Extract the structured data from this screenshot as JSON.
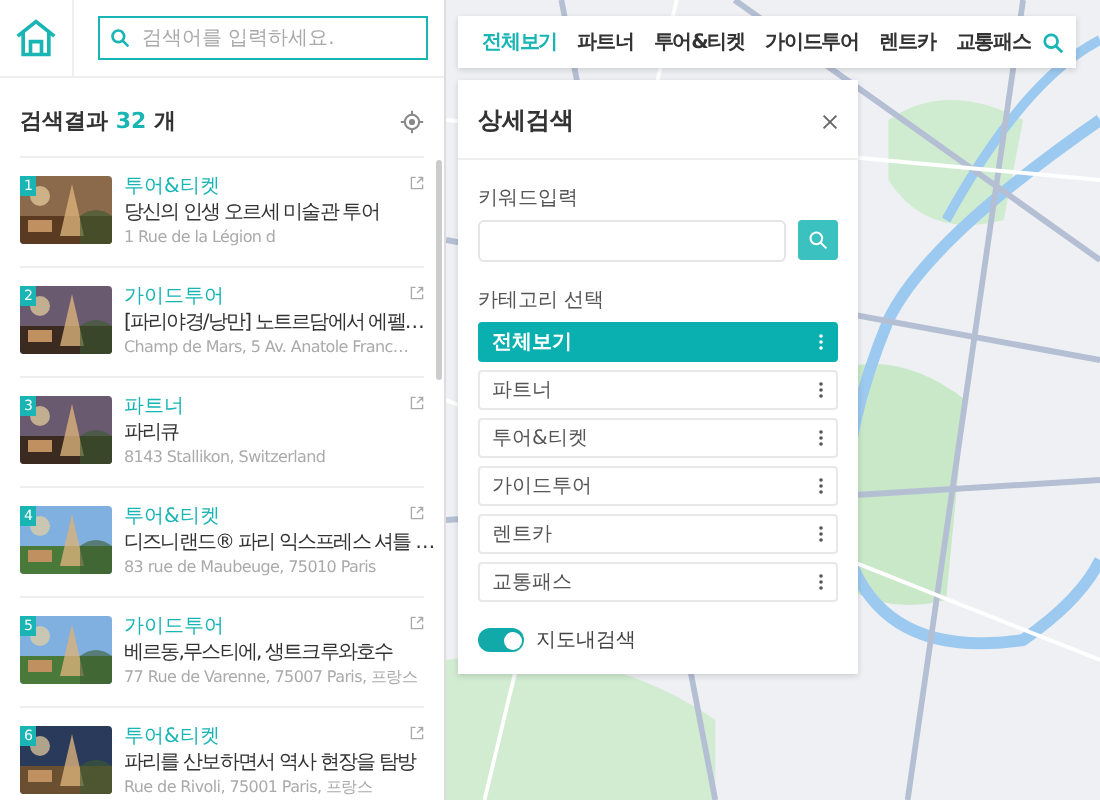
{
  "search": {
    "placeholder": "검색어를 입력하세요."
  },
  "results": {
    "label": "검색결과",
    "count": "32",
    "unit": "개",
    "items": [
      {
        "number": "1",
        "category": "투어&티켓",
        "title": "당신의 인생 오르세 미술관 투어",
        "address": "1 Rue de la Légion d"
      },
      {
        "number": "2",
        "category": "가이드투어",
        "title": "[파리야경/낭만] 노트르담에서 에펠…",
        "address": "Champ de Mars, 5 Av. Anatole Franc…"
      },
      {
        "number": "3",
        "category": "파트너",
        "title": "파리큐",
        "address": "8143 Stallikon, Switzerland"
      },
      {
        "number": "4",
        "category": "투어&티켓",
        "title": "디즈니랜드® 파리 익스프레스 셔틀 …",
        "address": "83 rue de Maubeuge, 75010 Paris"
      },
      {
        "number": "5",
        "category": "가이드투어",
        "title": "베르동,무스티에, 생트크루와호수",
        "address": "77 Rue de Varenne, 75007 Paris, 프랑스"
      },
      {
        "number": "6",
        "category": "투어&티켓",
        "title": "파리를 산보하면서 역사 현장을 탐방",
        "address": "Rue de Rivoli, 75001 Paris, 프랑스"
      }
    ]
  },
  "tabs": [
    {
      "label": "전체보기",
      "selected": true
    },
    {
      "label": "파트너",
      "selected": false
    },
    {
      "label": "투어&티켓",
      "selected": false
    },
    {
      "label": "가이드투어",
      "selected": false
    },
    {
      "label": "렌트카",
      "selected": false
    },
    {
      "label": "교통패스",
      "selected": false
    }
  ],
  "detail": {
    "title": "상세검색",
    "keyword_label": "키워드입력",
    "category_label": "카테고리 선택",
    "categories": [
      {
        "label": "전체보기",
        "selected": true
      },
      {
        "label": "파트너",
        "selected": false
      },
      {
        "label": "투어&티켓",
        "selected": false
      },
      {
        "label": "가이드투어",
        "selected": false
      },
      {
        "label": "렌트카",
        "selected": false
      },
      {
        "label": "교통패스",
        "selected": false
      }
    ],
    "map_search": {
      "label": "지도내검색",
      "on": true
    }
  }
}
